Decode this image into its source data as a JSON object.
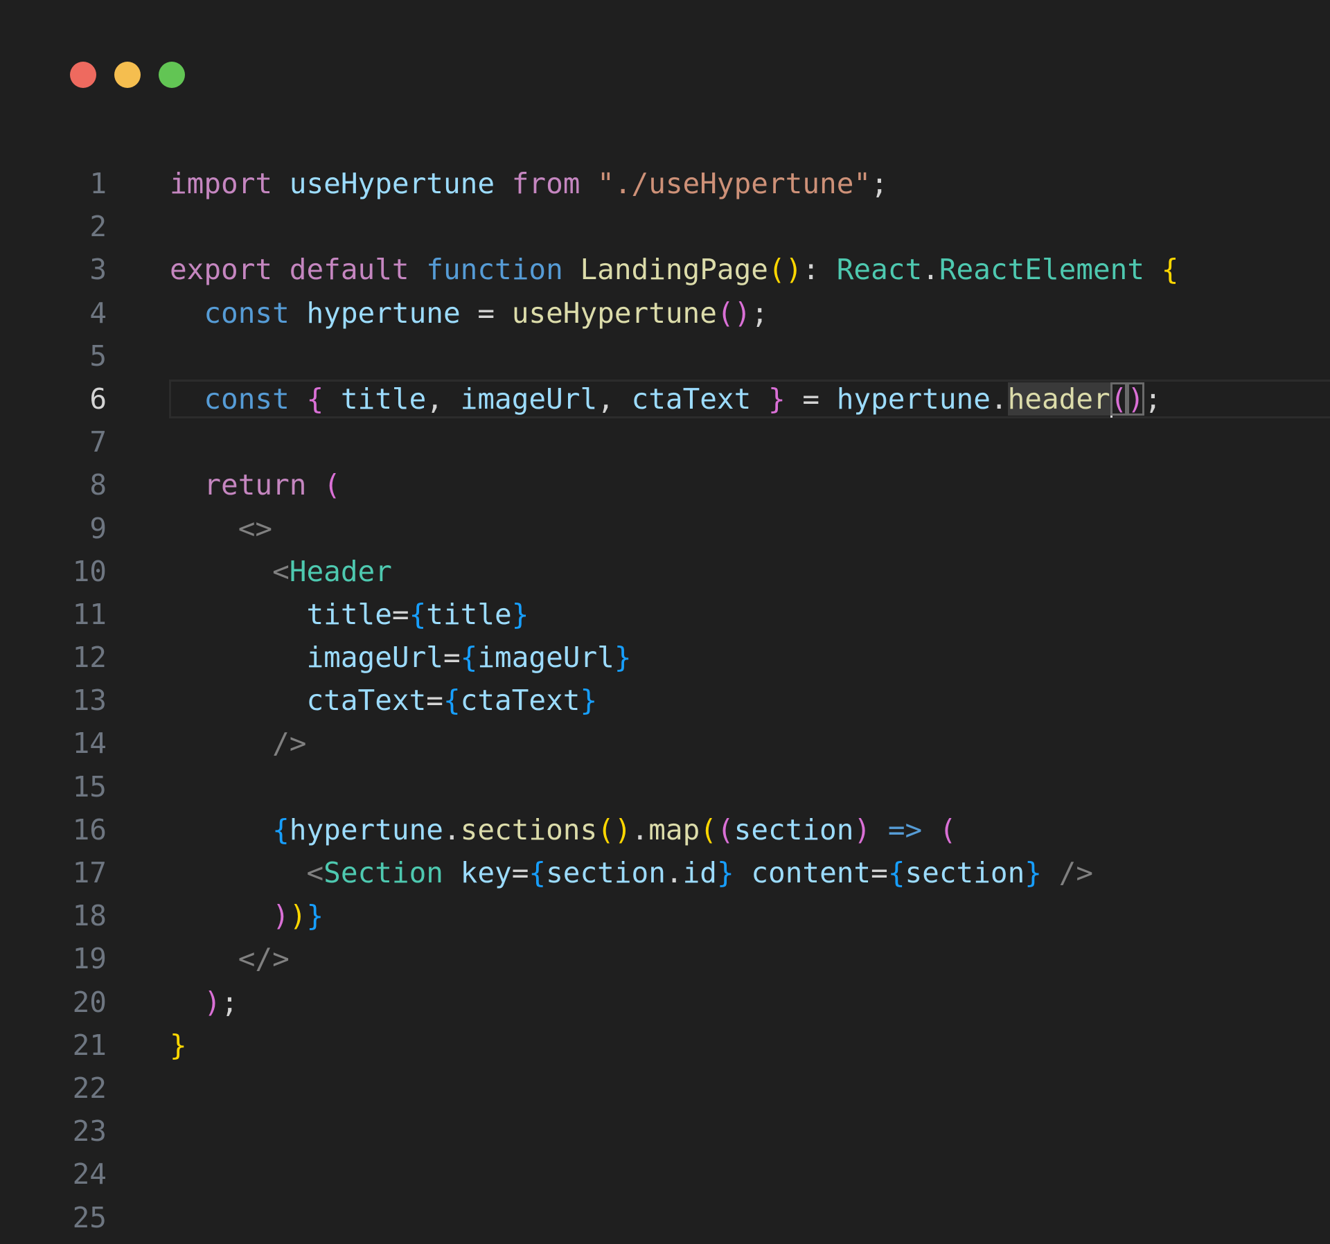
{
  "window": {
    "controls": [
      {
        "name": "close",
        "color": "#ee6a5f"
      },
      {
        "name": "minimize",
        "color": "#f5be4f"
      },
      {
        "name": "maximize",
        "color": "#62c554"
      }
    ]
  },
  "theme": {
    "background": "#1f1f1f",
    "line_number": "#6e7681",
    "line_number_active": "#d4d4d4",
    "colors": {
      "kw": "#c586c0",
      "var": "#9cdcfe",
      "fn": "#dcdcaa",
      "str": "#ce9178",
      "type": "#4ec9b0",
      "storage": "#569cd6",
      "plain": "#d4d4d4",
      "tag": "#808080",
      "b1": "#ffd700",
      "b2": "#da70d6",
      "b3": "#179fff"
    }
  },
  "editor": {
    "active_line": 6,
    "lines": [
      {
        "number": "1",
        "tokens": [
          {
            "t": "import",
            "c": "kw"
          },
          {
            "t": " ",
            "c": "plain"
          },
          {
            "t": "useHypertune",
            "c": "var"
          },
          {
            "t": " ",
            "c": "plain"
          },
          {
            "t": "from",
            "c": "kw"
          },
          {
            "t": " ",
            "c": "plain"
          },
          {
            "t": "\"./useHypertune\"",
            "c": "str"
          },
          {
            "t": ";",
            "c": "plain"
          }
        ]
      },
      {
        "number": "2",
        "tokens": []
      },
      {
        "number": "3",
        "tokens": [
          {
            "t": "export",
            "c": "kw"
          },
          {
            "t": " ",
            "c": "plain"
          },
          {
            "t": "default",
            "c": "kw"
          },
          {
            "t": " ",
            "c": "plain"
          },
          {
            "t": "function",
            "c": "storage"
          },
          {
            "t": " ",
            "c": "plain"
          },
          {
            "t": "LandingPage",
            "c": "fn"
          },
          {
            "t": "()",
            "c": "b1"
          },
          {
            "t": ": ",
            "c": "plain"
          },
          {
            "t": "React",
            "c": "type"
          },
          {
            "t": ".",
            "c": "plain"
          },
          {
            "t": "ReactElement",
            "c": "type"
          },
          {
            "t": " ",
            "c": "plain"
          },
          {
            "t": "{",
            "c": "b1"
          }
        ]
      },
      {
        "number": "4",
        "tokens": [
          {
            "t": "  ",
            "c": "plain"
          },
          {
            "t": "const",
            "c": "storage"
          },
          {
            "t": " ",
            "c": "plain"
          },
          {
            "t": "hypertune",
            "c": "var"
          },
          {
            "t": " = ",
            "c": "plain"
          },
          {
            "t": "useHypertune",
            "c": "fn"
          },
          {
            "t": "()",
            "c": "b2"
          },
          {
            "t": ";",
            "c": "plain"
          }
        ]
      },
      {
        "number": "5",
        "tokens": []
      },
      {
        "number": "6",
        "tokens": [
          {
            "t": "  ",
            "c": "plain"
          },
          {
            "t": "const",
            "c": "storage"
          },
          {
            "t": " ",
            "c": "plain"
          },
          {
            "t": "{",
            "c": "b2"
          },
          {
            "t": " ",
            "c": "plain"
          },
          {
            "t": "title",
            "c": "var"
          },
          {
            "t": ", ",
            "c": "plain"
          },
          {
            "t": "imageUrl",
            "c": "var"
          },
          {
            "t": ", ",
            "c": "plain"
          },
          {
            "t": "ctaText",
            "c": "var"
          },
          {
            "t": " ",
            "c": "plain"
          },
          {
            "t": "}",
            "c": "b2"
          },
          {
            "t": " = ",
            "c": "plain"
          },
          {
            "t": "hypertune",
            "c": "var"
          },
          {
            "t": ".",
            "c": "plain"
          },
          {
            "t": "header",
            "c": "fn",
            "hl": true
          },
          {
            "t": "(",
            "c": "b2",
            "cursor": true,
            "box": true
          },
          {
            "t": ")",
            "c": "b2",
            "box": true
          },
          {
            "t": ";",
            "c": "plain"
          }
        ]
      },
      {
        "number": "7",
        "tokens": []
      },
      {
        "number": "8",
        "tokens": [
          {
            "t": "  ",
            "c": "plain"
          },
          {
            "t": "return",
            "c": "kw"
          },
          {
            "t": " ",
            "c": "plain"
          },
          {
            "t": "(",
            "c": "b2"
          }
        ]
      },
      {
        "number": "9",
        "tokens": [
          {
            "t": "    ",
            "c": "plain"
          },
          {
            "t": "<>",
            "c": "tag"
          }
        ]
      },
      {
        "number": "10",
        "tokens": [
          {
            "t": "      ",
            "c": "plain"
          },
          {
            "t": "<",
            "c": "tag"
          },
          {
            "t": "Header",
            "c": "type"
          }
        ]
      },
      {
        "number": "11",
        "tokens": [
          {
            "t": "        ",
            "c": "plain"
          },
          {
            "t": "title",
            "c": "var"
          },
          {
            "t": "=",
            "c": "plain"
          },
          {
            "t": "{",
            "c": "b3"
          },
          {
            "t": "title",
            "c": "var"
          },
          {
            "t": "}",
            "c": "b3"
          }
        ]
      },
      {
        "number": "12",
        "tokens": [
          {
            "t": "        ",
            "c": "plain"
          },
          {
            "t": "imageUrl",
            "c": "var"
          },
          {
            "t": "=",
            "c": "plain"
          },
          {
            "t": "{",
            "c": "b3"
          },
          {
            "t": "imageUrl",
            "c": "var"
          },
          {
            "t": "}",
            "c": "b3"
          }
        ]
      },
      {
        "number": "13",
        "tokens": [
          {
            "t": "        ",
            "c": "plain"
          },
          {
            "t": "ctaText",
            "c": "var"
          },
          {
            "t": "=",
            "c": "plain"
          },
          {
            "t": "{",
            "c": "b3"
          },
          {
            "t": "ctaText",
            "c": "var"
          },
          {
            "t": "}",
            "c": "b3"
          }
        ]
      },
      {
        "number": "14",
        "tokens": [
          {
            "t": "      ",
            "c": "plain"
          },
          {
            "t": "/>",
            "c": "tag"
          }
        ]
      },
      {
        "number": "15",
        "tokens": []
      },
      {
        "number": "16",
        "tokens": [
          {
            "t": "      ",
            "c": "plain"
          },
          {
            "t": "{",
            "c": "b3"
          },
          {
            "t": "hypertune",
            "c": "var"
          },
          {
            "t": ".",
            "c": "plain"
          },
          {
            "t": "sections",
            "c": "fn"
          },
          {
            "t": "()",
            "c": "b1"
          },
          {
            "t": ".",
            "c": "plain"
          },
          {
            "t": "map",
            "c": "fn"
          },
          {
            "t": "(",
            "c": "b1"
          },
          {
            "t": "(",
            "c": "b2"
          },
          {
            "t": "section",
            "c": "var"
          },
          {
            "t": ")",
            "c": "b2"
          },
          {
            "t": " ",
            "c": "plain"
          },
          {
            "t": "=>",
            "c": "storage"
          },
          {
            "t": " ",
            "c": "plain"
          },
          {
            "t": "(",
            "c": "b2"
          }
        ]
      },
      {
        "number": "17",
        "tokens": [
          {
            "t": "        ",
            "c": "plain"
          },
          {
            "t": "<",
            "c": "tag"
          },
          {
            "t": "Section",
            "c": "type"
          },
          {
            "t": " ",
            "c": "plain"
          },
          {
            "t": "key",
            "c": "var"
          },
          {
            "t": "=",
            "c": "plain"
          },
          {
            "t": "{",
            "c": "b3"
          },
          {
            "t": "section",
            "c": "var"
          },
          {
            "t": ".",
            "c": "plain"
          },
          {
            "t": "id",
            "c": "var"
          },
          {
            "t": "}",
            "c": "b3"
          },
          {
            "t": " ",
            "c": "plain"
          },
          {
            "t": "content",
            "c": "var"
          },
          {
            "t": "=",
            "c": "plain"
          },
          {
            "t": "{",
            "c": "b3"
          },
          {
            "t": "section",
            "c": "var"
          },
          {
            "t": "}",
            "c": "b3"
          },
          {
            "t": " ",
            "c": "plain"
          },
          {
            "t": "/>",
            "c": "tag"
          }
        ]
      },
      {
        "number": "18",
        "tokens": [
          {
            "t": "      ",
            "c": "plain"
          },
          {
            "t": ")",
            "c": "b2"
          },
          {
            "t": ")",
            "c": "b1"
          },
          {
            "t": "}",
            "c": "b3"
          }
        ]
      },
      {
        "number": "19",
        "tokens": [
          {
            "t": "    ",
            "c": "plain"
          },
          {
            "t": "</>",
            "c": "tag"
          }
        ]
      },
      {
        "number": "20",
        "tokens": [
          {
            "t": "  ",
            "c": "plain"
          },
          {
            "t": ")",
            "c": "b2"
          },
          {
            "t": ";",
            "c": "plain"
          }
        ]
      },
      {
        "number": "21",
        "tokens": [
          {
            "t": "}",
            "c": "b1"
          }
        ]
      },
      {
        "number": "22",
        "tokens": []
      },
      {
        "number": "23",
        "tokens": []
      },
      {
        "number": "24",
        "tokens": []
      },
      {
        "number": "25",
        "tokens": []
      }
    ]
  }
}
